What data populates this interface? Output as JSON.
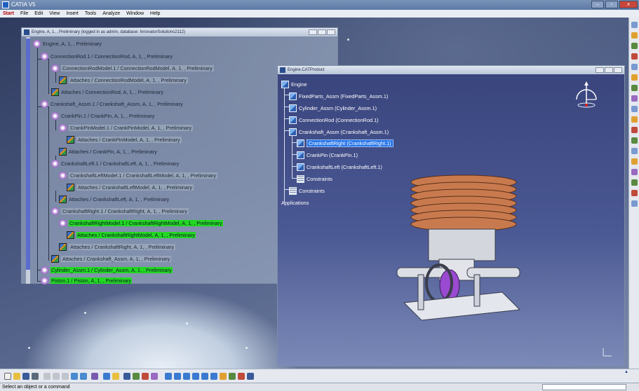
{
  "app": {
    "title": "CATIA V5",
    "menu": [
      "Start",
      "File",
      "Edit",
      "View",
      "Insert",
      "Tools",
      "Analyze",
      "Window",
      "Help"
    ]
  },
  "status_text": "Select an object or a command",
  "window1": {
    "title": "Engine, A, 1, , Preliminary (logged in as admin, database: InnovatorSolutions2112)",
    "rows": [
      {
        "label": "Engine, A, 1, , Preliminary",
        "icon": "gear-icon"
      },
      {
        "label": "ConnectionRod.1 / ConnectionRod, A, 1, , Preliminary",
        "icon": "gear-icon"
      },
      {
        "label": "ConnectionRodModel.1 / ConnectionRodModel, A, 1, , Preliminary",
        "icon": "gear-icon"
      },
      {
        "label": "Attaches / ConnectionRodModel, A, 1, , Preliminary",
        "icon": "document-icon"
      },
      {
        "label": "Attaches / ConnectionRod, A, 1, , Preliminary",
        "icon": "document-icon"
      },
      {
        "label": "Crankshaft_Assm.1 / Crankshaft_Assm, A, 1, , Preliminary",
        "icon": "gear-icon"
      },
      {
        "label": "CrankPin.1 / CrankPin, A, 1, , Preliminary",
        "icon": "gear-icon"
      },
      {
        "label": "CrankPinModel.1 / CrankPinModel, A, 1, , Preliminary",
        "icon": "gear-icon"
      },
      {
        "label": "Attaches / CrankPinModel, A, 1, , Preliminary",
        "icon": "document-icon"
      },
      {
        "label": "Attaches / CrankPin, A, 1, , Preliminary",
        "icon": "document-icon"
      },
      {
        "label": "CrankshaftLeft.1 / CrankshaftLeft, A, 1, , Preliminary",
        "icon": "gear-icon"
      },
      {
        "label": "CrankshaftLeftModel.1 / CrankshaftLeftModel, A, 1, , Preliminary",
        "icon": "gear-icon"
      },
      {
        "label": "Attaches / CrankshaftLeftModel, A, 1, , Preliminary",
        "icon": "document-icon"
      },
      {
        "label": "Attaches / CrankshaftLeft, A, 1, , Preliminary",
        "icon": "document-icon"
      },
      {
        "label": "CrankshaftRight.1 / CrankshaftRight, A, 1, , Preliminary",
        "icon": "gear-icon"
      },
      {
        "label": "CrankshaftRightModel.1 / CrankshaftRightModel, A, 1, , Preliminary",
        "icon": "gear-icon"
      },
      {
        "label": "Attaches / CrankshaftRightModel, A, 1, , Preliminary",
        "icon": "document-icon"
      },
      {
        "label": "Attaches / CrankshaftRight, A, 1, , Preliminary",
        "icon": "document-icon"
      },
      {
        "label": "Attaches / Crankshaft_Assm, A, 1, , Preliminary",
        "icon": "document-icon"
      },
      {
        "label": "Cylinder_Assm.1 / Cylinder_Assm, A, 1, , Preliminary",
        "icon": "gear-icon"
      },
      {
        "label": "Piston.1 / Piston, A, 1, , Preliminary",
        "icon": "gear-icon"
      }
    ]
  },
  "window2": {
    "title": "Engine.CATProduct",
    "rows": [
      {
        "label": "Engine",
        "icon": "product-icon"
      },
      {
        "label": "FixedParts_Assm (FixedParts_Assm.1)",
        "icon": "product-icon"
      },
      {
        "label": "Cylinder_Assm (Cylinder_Assm.1)",
        "icon": "product-icon"
      },
      {
        "label": "ConnectionRod (ConnectionRod.1)",
        "icon": "product-icon"
      },
      {
        "label": "Crankshaft_Assm (Crankshaft_Assm.1)",
        "icon": "product-icon"
      },
      {
        "label": "CrankshaftRight (CrankshaftRight.1)",
        "icon": "product-icon"
      },
      {
        "label": "CrankPin (CrankPin.1)",
        "icon": "product-icon"
      },
      {
        "label": "CrankshaftLeft (CrankshaftLeft.1)",
        "icon": "product-icon"
      },
      {
        "label": "Constraints",
        "icon": "constraints-icon"
      },
      {
        "label": "Constraints",
        "icon": "constraints-icon"
      },
      {
        "label": "Applications",
        "icon": "none"
      }
    ]
  },
  "colors": {
    "highlight_green": "#22d822",
    "selection_blue": "#2a77e8"
  }
}
